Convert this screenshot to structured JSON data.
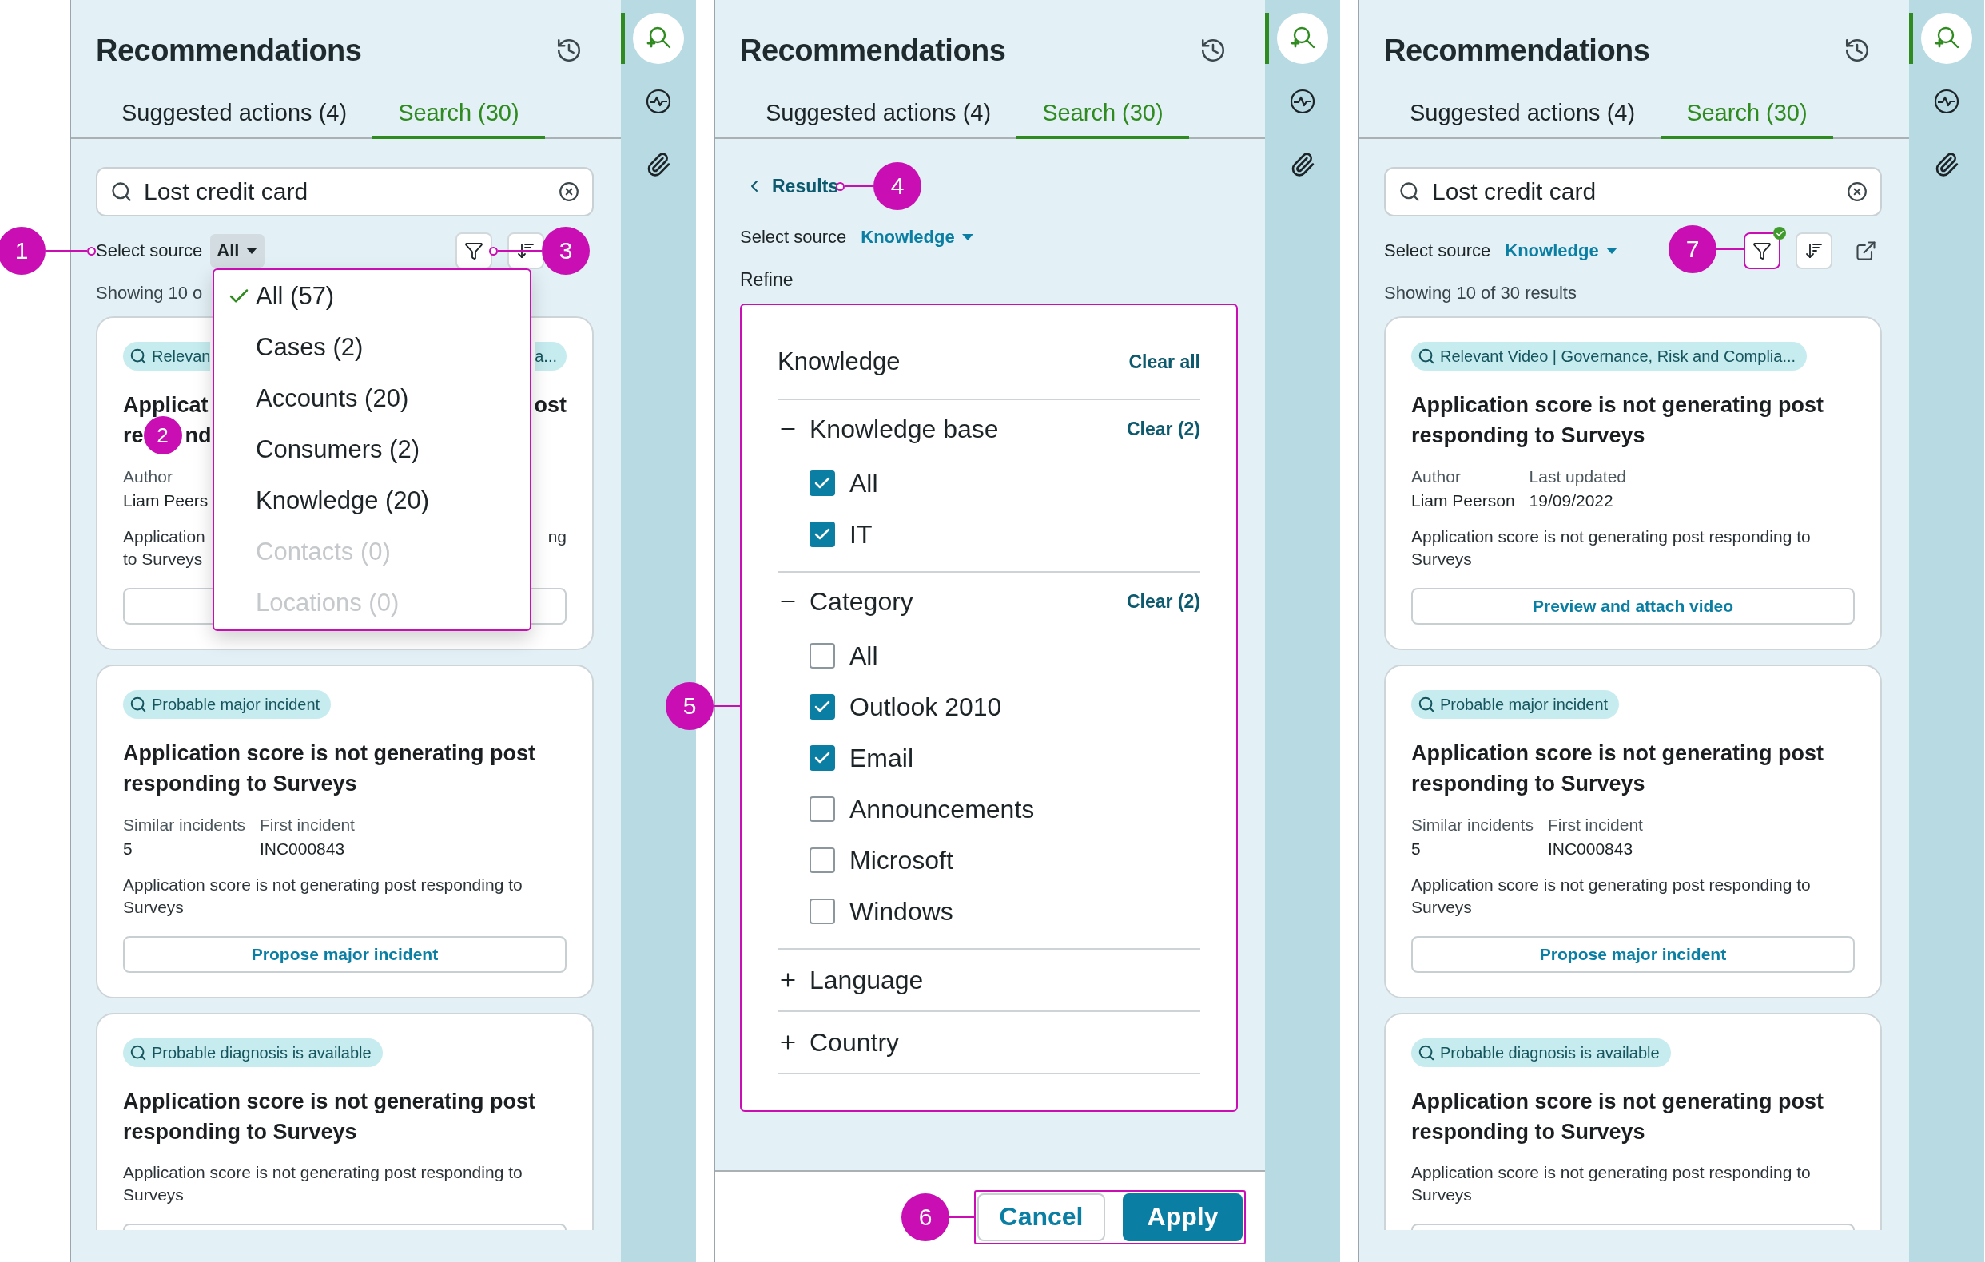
{
  "panels": [
    {
      "kind": "results",
      "title": "Recommendations",
      "tabs": [
        {
          "label": "Suggested actions (4)",
          "selected": false
        },
        {
          "label": "Search (30)",
          "selected": true
        }
      ],
      "search": {
        "value": "Lost credit card"
      },
      "source": {
        "label": "Select source",
        "value": "All",
        "open": true
      },
      "toolbar": {
        "filter_highlighted": false,
        "filter_applied": false
      },
      "showing": "Showing 10 o",
      "dropdown": {
        "options": [
          {
            "label": "All (57)",
            "selected": true,
            "disabled": false
          },
          {
            "label": "Cases (2)",
            "selected": false,
            "disabled": false
          },
          {
            "label": "Accounts (20)",
            "selected": false,
            "disabled": false
          },
          {
            "label": "Consumers (2)",
            "selected": false,
            "disabled": false
          },
          {
            "label": "Knowledge (20)",
            "selected": false,
            "disabled": false
          },
          {
            "label": "Contacts (0)",
            "selected": false,
            "disabled": true
          },
          {
            "label": "Locations (0)",
            "selected": false,
            "disabled": true
          }
        ]
      },
      "cards": [
        {
          "kind": "partial",
          "tag_start": "Relevan",
          "tag_end": "a...",
          "rows": [
            {
              "left": "Applicat",
              "right": "ost"
            },
            {
              "left": "re",
              "callout": "2",
              "after": "nd"
            },
            {
              "left": "Author"
            },
            {
              "left": "Liam Peers"
            },
            {
              "left": "Application",
              "right": "ng"
            },
            {
              "left": "to Surveys"
            }
          ]
        },
        {
          "kind": "full",
          "tag": "Probable major incident",
          "title": "Application score is not generating post responding to Surveys",
          "fields": [
            {
              "label": "Similar incidents",
              "value": "5"
            },
            {
              "label": "First incident",
              "value": "INC000843"
            }
          ],
          "text": "Application score is not generating post responding to Surveys",
          "action": "Propose major incident"
        },
        {
          "kind": "clipped",
          "tag": "Probable diagnosis is available",
          "title": "Application score is not generating post responding to Surveys",
          "text": "Application score is not generating post responding to Surveys"
        }
      ],
      "rail": [
        {
          "kind": "search",
          "selected": true
        },
        {
          "kind": "activity",
          "selected": false
        },
        {
          "kind": "attachment",
          "selected": false
        }
      ]
    },
    {
      "kind": "refine",
      "title": "Recommendations",
      "tabs": [
        {
          "label": "Suggested actions (4)",
          "selected": false
        },
        {
          "label": "Search (30)",
          "selected": true
        }
      ],
      "back": "Results",
      "source": {
        "label": "Select source",
        "value": "Knowledge",
        "open": false
      },
      "refine_label": "Refine",
      "refine": {
        "title": "Knowledge",
        "clear": "Clear all",
        "groups": [
          {
            "label": "Knowledge base",
            "expanded": true,
            "clear": "Clear (2)",
            "options": [
              {
                "label": "All",
                "checked": true
              },
              {
                "label": "IT",
                "checked": true
              }
            ]
          },
          {
            "label": "Category",
            "expanded": true,
            "clear": "Clear (2)",
            "options": [
              {
                "label": "All",
                "checked": false
              },
              {
                "label": "Outlook 2010",
                "checked": true
              },
              {
                "label": "Email",
                "checked": true
              },
              {
                "label": "Announcements",
                "checked": false
              },
              {
                "label": "Microsoft",
                "checked": false
              },
              {
                "label": "Windows",
                "checked": false
              }
            ]
          },
          {
            "label": "Language",
            "expanded": false
          },
          {
            "label": "Country",
            "expanded": false
          }
        ]
      },
      "buttons": [
        {
          "label": "Cancel",
          "kind": "secondary"
        },
        {
          "label": "Apply",
          "kind": "primary"
        }
      ],
      "rail": [
        {
          "kind": "search",
          "selected": true
        },
        {
          "kind": "activity",
          "selected": false
        },
        {
          "kind": "attachment",
          "selected": false
        }
      ]
    },
    {
      "kind": "results",
      "title": "Recommendations",
      "tabs": [
        {
          "label": "Suggested actions (4)",
          "selected": false
        },
        {
          "label": "Search (30)",
          "selected": true
        }
      ],
      "search": {
        "value": "Lost credit card"
      },
      "source": {
        "label": "Select source",
        "value": "Knowledge",
        "open": false
      },
      "toolbar": {
        "filter_highlighted": true,
        "filter_applied": true,
        "external_link": true
      },
      "showing": "Showing 10 of 30 results",
      "cards": [
        {
          "kind": "full",
          "tag": "Relevant Video | Governance, Risk and Complia...",
          "title": "Application score is not generating post responding to Surveys",
          "fields": [
            {
              "label": "Author",
              "value": "Liam Peerson"
            },
            {
              "label": "Last updated",
              "value": "19/09/2022"
            }
          ],
          "text": "Application score is not generating post responding to Surveys",
          "action": "Preview and attach video"
        },
        {
          "kind": "full",
          "tag": "Probable major incident",
          "title": "Application score is not generating post responding to Surveys",
          "fields": [
            {
              "label": "Similar incidents",
              "value": "5"
            },
            {
              "label": "First incident",
              "value": "INC000843"
            }
          ],
          "text": "Application score is not generating post responding to Surveys",
          "action": "Propose major incident"
        },
        {
          "kind": "clipped",
          "tag": "Probable diagnosis is available",
          "title": "Application score is not generating post responding to Surveys",
          "text": "Application score is not generating post responding to Surveys"
        }
      ],
      "rail": [
        {
          "kind": "search",
          "selected": true
        },
        {
          "kind": "activity",
          "selected": false
        },
        {
          "kind": "attachment",
          "selected": false
        }
      ]
    }
  ],
  "callouts": [
    {
      "number": "1"
    },
    {
      "number": "3"
    },
    {
      "number": "4"
    },
    {
      "number": "5"
    },
    {
      "number": "6"
    },
    {
      "number": "7"
    }
  ]
}
